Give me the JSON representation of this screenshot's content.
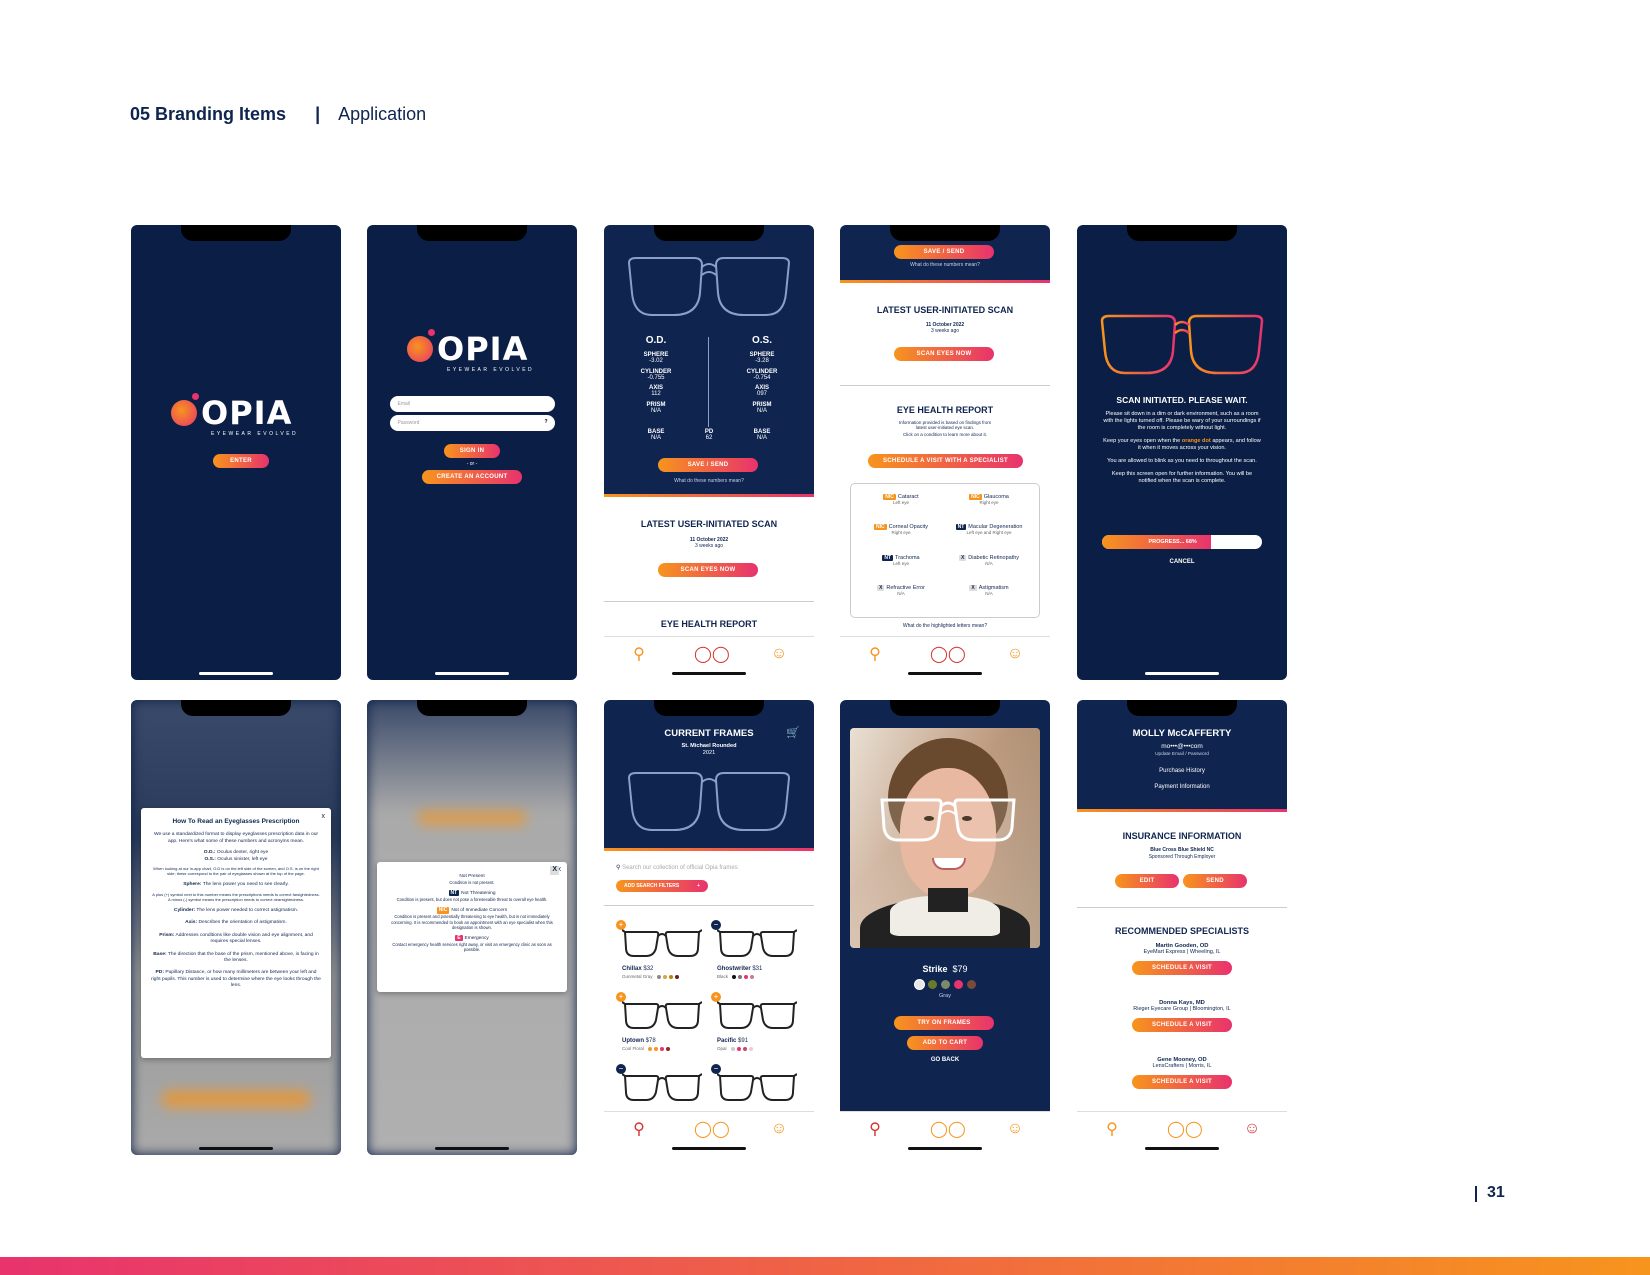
{
  "header": {
    "section": "05  Branding Items",
    "separator": "|",
    "sub": "Application"
  },
  "page_number": "31",
  "brand": {
    "word": "OPIA",
    "tagline": "EYEWEAR EVOLVED"
  },
  "colors": {
    "navy": "#0f2550",
    "orange": "#f7941d",
    "pink": "#e8336d"
  },
  "nav_icons": [
    "search-icon",
    "glasses-icon",
    "profile-icon"
  ],
  "s1": {
    "enter": "ENTER"
  },
  "s2": {
    "email_placeholder": "Email",
    "password_placeholder": "Password",
    "help": "?",
    "signin": "SIGN IN",
    "or": "- or -",
    "create": "CREATE AN ACCOUNT"
  },
  "s3": {
    "od": "O.D.",
    "os": "O.S.",
    "od_rows": [
      [
        "SPHERE",
        "-3.02"
      ],
      [
        "CYLINDER",
        "-0.755"
      ],
      [
        "AXIS",
        "112"
      ],
      [
        "PRISM",
        "N/A"
      ]
    ],
    "os_rows": [
      [
        "SPHERE",
        "-3.28"
      ],
      [
        "CYLINDER",
        "-0.754"
      ],
      [
        "AXIS",
        "097"
      ],
      [
        "PRISM",
        "N/A"
      ]
    ],
    "base_l": "BASE",
    "base_l_val": "N/A",
    "pd": "PD",
    "pd_val": "62",
    "base_r": "BASE",
    "base_r_val": "N/A",
    "save": "SAVE / SEND",
    "numbers_link": "What do these numbers mean?",
    "latest": "LATEST USER-INITIATED SCAN",
    "date": "11 October 2022",
    "ago": "3 weeks ago",
    "scan": "SCAN EYES NOW",
    "ehr": "EYE HEALTH REPORT"
  },
  "s4": {
    "save": "SAVE / SEND",
    "numbers_link": "What do these numbers mean?",
    "latest": "LATEST USER-INITIATED SCAN",
    "date": "11 October 2022",
    "ago": "3 weeks ago",
    "scan": "SCAN EYES NOW",
    "ehr": "EYE HEALTH REPORT",
    "ehr_note1": "Information provided is based on findings from",
    "ehr_note2": "latest user-initiated eye scan.",
    "ehr_note3": "Click on a condition to learn more about it.",
    "schedule": "SCHEDULE A VISIT WITH A SPECIALIST",
    "conditions": [
      {
        "tag": "NIC",
        "name": "Cataract",
        "eye": "Left eye"
      },
      {
        "tag": "NIC",
        "name": "Glaucoma",
        "eye": "Right eye"
      },
      {
        "tag": "NIC",
        "name": "Corneal Opacity",
        "eye": "Right eye"
      },
      {
        "tag": "NT",
        "name": "Macular Degeneration",
        "eye": "Left eye and Right eye"
      },
      {
        "tag": "NT",
        "name": "Trachoma",
        "eye": "Left eye"
      },
      {
        "tag": "X",
        "name": "Diabetic Retinopathy",
        "eye": "N/A"
      },
      {
        "tag": "X",
        "name": "Refractive Error",
        "eye": "N/A"
      },
      {
        "tag": "X",
        "name": "Astigmatism",
        "eye": "N/A"
      }
    ],
    "letters_link": "What do the highlighted letters mean?"
  },
  "s5": {
    "title": "SCAN INITIATED. PLEASE WAIT.",
    "p1": "Please sit down in a dim or dark environment, such as a room with the lights turned off. Please be wary of your surroundings if the room is completely without light.",
    "p2a": "Keep your eyes open when the",
    "p2b": "orange dot",
    "p2c": "appears, and follow it when it moves across your vision.",
    "p3": "You are allowed to blink as you need to throughout the scan.",
    "p4": "Keep this screen open for further information. You will be notified when the scan is complete.",
    "progress_label": "PROGRESS... 68%",
    "progress": 0.68,
    "cancel": "CANCEL"
  },
  "s6": {
    "title": "How To Read an Eyeglasses Prescription",
    "close": "x",
    "intro": "We use a standardized format to display eyeglasses prescription data in our app. Here's what some of these numbers and acronyms mean.",
    "od_k": "O.D.:",
    "od_v": "Oculus dexter, right eye",
    "os_k": "O.S.:",
    "os_v": "Oculus sinister, left eye",
    "chart": "When looking at our in-app chart, O.D is on the left side of the screen, and O.S. is on the right side; these correspond to the pair of eyeglasses shown at the top of the page.",
    "sph_k": "Sphere:",
    "sph_v": "The lens power you need to see clearly.",
    "sph2": "A plus (+) symbol next to this number means the prescriptions needs to correct farsightedness. A minus (-) symbol means the prescription needs to correct nearsightedness.",
    "cyl_k": "Cylinder:",
    "cyl_v": "The lens power needed to correct astigmatism.",
    "axis_k": "Axis:",
    "axis_v": "Describes the orientation of astigmatism.",
    "prism_k": "Prism:",
    "prism_v": "Addresses conditions like double vision and eye alignment, and requires special lenses.",
    "base_k": "Base:",
    "base_v": "The direction that the base of the prism, mentioned above, is facing in the lenses.",
    "pd_k": "PD:",
    "pd_v": "Pupillary Distance, or how many millimeters are between your left and right pupils. This number is used to determine where the eye looks through the lens."
  },
  "s7": {
    "close": "x",
    "items": [
      {
        "tag": "X",
        "label": "Not Present",
        "desc": "Condition is not present."
      },
      {
        "tag": "NT",
        "label": "Not Threatening",
        "desc": "Condition is present, but does not pose a foreseeable threat to overall eye health."
      },
      {
        "tag": "NIC",
        "label": "Not of Immediate Concern",
        "desc": "Condition is present and potentially threatening to eye health, but is not immediately concerning. It is recommended to book an appointment with an eye specialist when this designation is shown."
      },
      {
        "tag": "E",
        "label": "Emergency",
        "desc": "Contact emergency health services right away, or visit an emergency clinic as soon as possible."
      }
    ]
  },
  "s8": {
    "title": "CURRENT FRAMES",
    "model": "St. Michael Rounded",
    "year": "2021",
    "search_placeholder": "Search our collection of official Opia frames",
    "filters": "ADD SEARCH FILTERS",
    "filters_plus": "+",
    "frames": [
      {
        "name": "Chillax",
        "price": "$32",
        "color": "Gunmetal Gray",
        "badge": "+",
        "swatches": [
          "#8a8a8a",
          "#d9a441",
          "#b8860b",
          "#6b1e1e"
        ]
      },
      {
        "name": "Ghostwriter",
        "price": "$31",
        "color": "Black",
        "badge": "−",
        "swatches": [
          "#111",
          "#777",
          "#e8336d",
          "#c97b9a"
        ]
      },
      {
        "name": "Uptown",
        "price": "$78",
        "color": "Cool Floral",
        "badge": "+",
        "swatches": [
          "#e8a030",
          "#f7941d",
          "#e8336d",
          "#8b2a2a"
        ]
      },
      {
        "name": "Pacific",
        "price": "$91",
        "color": "Opal",
        "badge": "+",
        "swatches": [
          "#cccccc",
          "#e8336d",
          "#c24b6a",
          "#f0c8d8"
        ]
      },
      {
        "name": "",
        "price": "",
        "color": "",
        "badge": "−",
        "swatches": []
      },
      {
        "name": "",
        "price": "",
        "color": "",
        "badge": "−",
        "swatches": []
      }
    ]
  },
  "s9": {
    "name": "Strike",
    "price": "$79",
    "color": "Gray",
    "swatches": [
      "#e8e8e8",
      "#6b7a2a",
      "#7a8a6a",
      "#e8336d",
      "#7a4a3a"
    ],
    "try": "TRY ON FRAMES",
    "cart": "ADD TO CART",
    "back": "GO BACK"
  },
  "s10": {
    "name": "MOLLY McCAFFERTY",
    "email": "mo•••@•••com",
    "update": "Update Email / Password",
    "purchase": "Purchase History",
    "payment": "Payment Information",
    "ins_title": "INSURANCE INFORMATION",
    "ins_name": "Blue Cross Blue Shield NC",
    "ins_sub": "Sponsored Through Employer",
    "edit": "EDIT",
    "send": "SEND",
    "rec_title": "RECOMMENDED SPECIALISTS",
    "specialists": [
      {
        "name": "Martin Gooden, OD",
        "place": "EyeMart Express  |  Wheeling, IL",
        "btn": "SCHEDULE A VISIT"
      },
      {
        "name": "Donna Kays, MD",
        "place": "Rieger Eyecare Group  |  Bloomington, IL",
        "btn": "SCHEDULE A VISIT"
      },
      {
        "name": "Gene Mooney, OD",
        "place": "LensCrafters  |  Morris, IL",
        "btn": "SCHEDULE A VISIT"
      }
    ]
  }
}
